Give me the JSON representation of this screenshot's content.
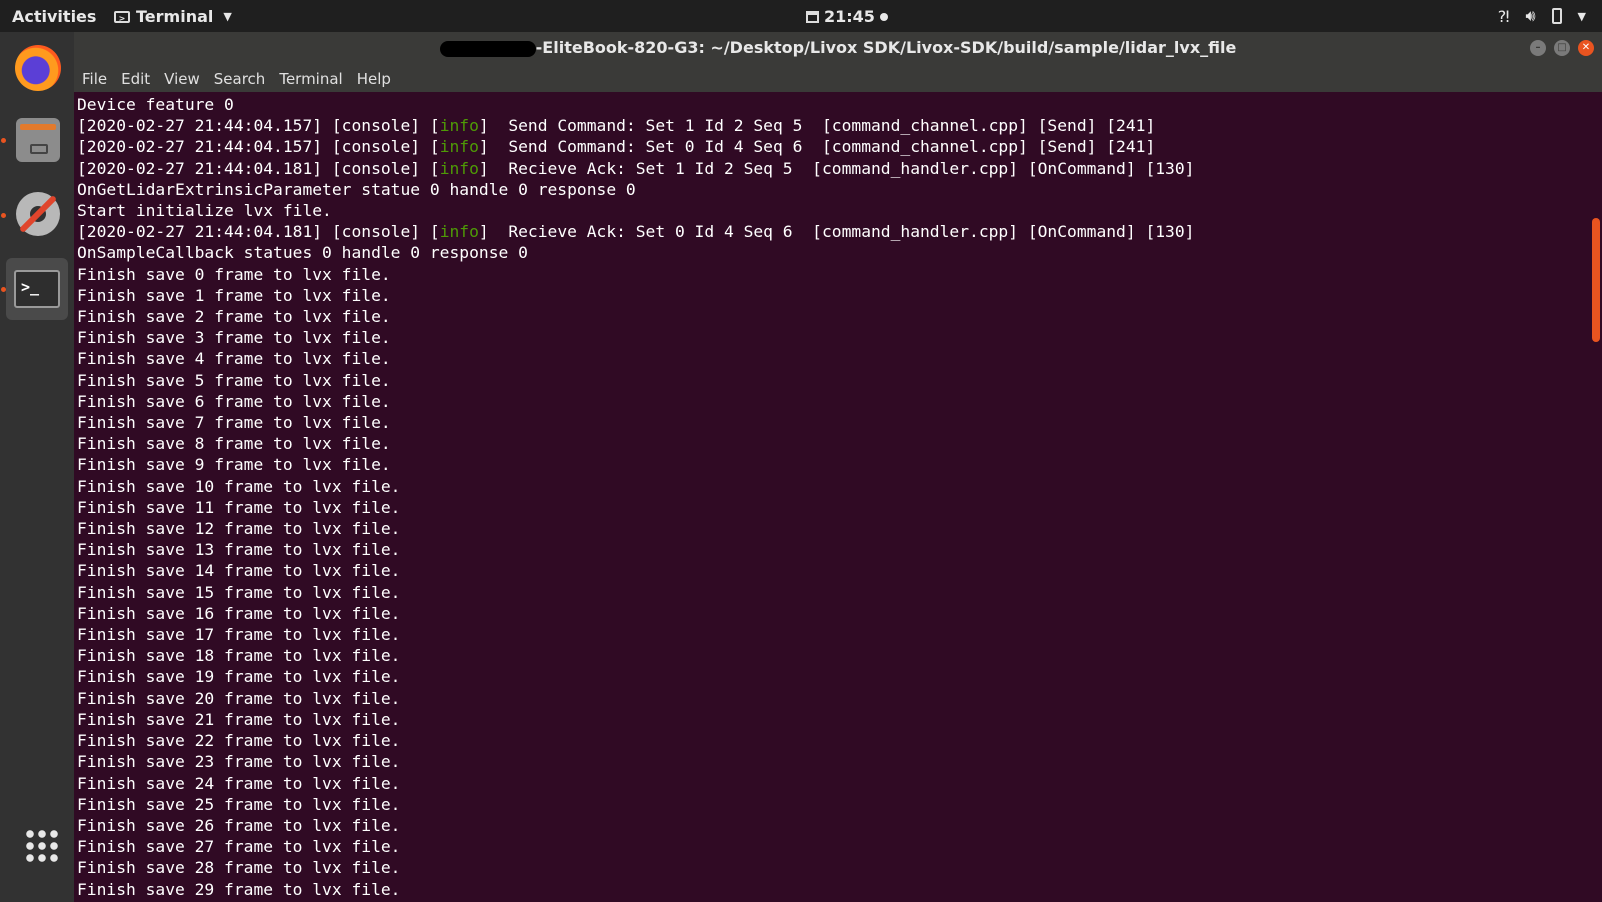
{
  "topbar": {
    "activities": "Activities",
    "app_name": "Terminal",
    "clock": "21:45"
  },
  "dock": {
    "items": [
      {
        "name": "Firefox",
        "icon": "firefox-icon",
        "running": false
      },
      {
        "name": "Files",
        "icon": "files-icon",
        "running": true
      },
      {
        "name": "Settings",
        "icon": "settings-icon",
        "running": true
      },
      {
        "name": "Terminal",
        "icon": "terminal-icon",
        "running": true,
        "active": true
      }
    ],
    "show_apps_icon": "grid-icon"
  },
  "window": {
    "title_suffix": "-EliteBook-820-G3: ~/Desktop/Livox SDK/Livox-SDK/build/sample/lidar_lvx_file",
    "menu": [
      "File",
      "Edit",
      "View",
      "Search",
      "Terminal",
      "Help"
    ]
  },
  "terminal": {
    "header_lines": [
      "Device feature 0"
    ],
    "log_lines": [
      {
        "pre": "[2020-02-27 21:44:04.157] [console] [",
        "level": "info",
        "post": "]  Send Command: Set 1 Id 2 Seq 5  [command_channel.cpp] [Send] [241]"
      },
      {
        "pre": "[2020-02-27 21:44:04.157] [console] [",
        "level": "info",
        "post": "]  Send Command: Set 0 Id 4 Seq 6  [command_channel.cpp] [Send] [241]"
      },
      {
        "pre": "[2020-02-27 21:44:04.181] [console] [",
        "level": "info",
        "post": "]  Recieve Ack: Set 1 Id 2 Seq 5  [command_handler.cpp] [OnCommand] [130]"
      }
    ],
    "mid_lines": [
      "OnGetLidarExtrinsicParameter statue 0 handle 0 response 0",
      "Start initialize lvx file."
    ],
    "log_line_2": {
      "pre": "[2020-02-27 21:44:04.181] [console] [",
      "level": "info",
      "post": "]  Recieve Ack: Set 0 Id 4 Seq 6  [command_handler.cpp] [OnCommand] [130]"
    },
    "callback_line": "OnSampleCallback statues 0 handle 0 response 0",
    "frames": [
      "Finish save 0 frame to lvx file.",
      "Finish save 1 frame to lvx file.",
      "Finish save 2 frame to lvx file.",
      "Finish save 3 frame to lvx file.",
      "Finish save 4 frame to lvx file.",
      "Finish save 5 frame to lvx file.",
      "Finish save 6 frame to lvx file.",
      "Finish save 7 frame to lvx file.",
      "Finish save 8 frame to lvx file.",
      "Finish save 9 frame to lvx file.",
      "Finish save 10 frame to lvx file.",
      "Finish save 11 frame to lvx file.",
      "Finish save 12 frame to lvx file.",
      "Finish save 13 frame to lvx file.",
      "Finish save 14 frame to lvx file.",
      "Finish save 15 frame to lvx file.",
      "Finish save 16 frame to lvx file.",
      "Finish save 17 frame to lvx file.",
      "Finish save 18 frame to lvx file.",
      "Finish save 19 frame to lvx file.",
      "Finish save 20 frame to lvx file.",
      "Finish save 21 frame to lvx file.",
      "Finish save 22 frame to lvx file.",
      "Finish save 23 frame to lvx file.",
      "Finish save 24 frame to lvx file.",
      "Finish save 25 frame to lvx file.",
      "Finish save 26 frame to lvx file.",
      "Finish save 27 frame to lvx file.",
      "Finish save 28 frame to lvx file.",
      "Finish save 29 frame to lvx file."
    ]
  },
  "colors": {
    "terminal_bg": "#300a24",
    "info_text": "#4e9a06",
    "accent": "#e95420"
  }
}
